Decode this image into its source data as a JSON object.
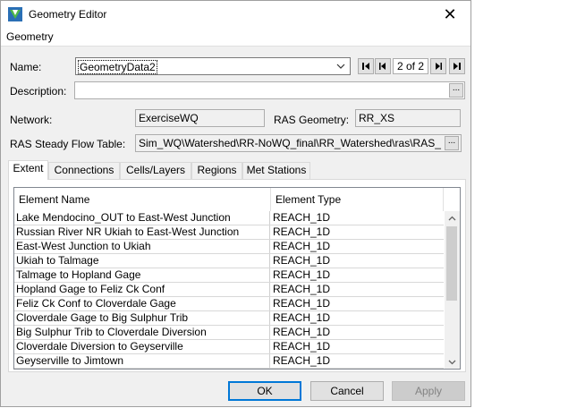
{
  "window": {
    "title": "Geometry Editor"
  },
  "menu": {
    "items": [
      "Geometry"
    ]
  },
  "name": {
    "label": "Name:",
    "value": "GeometryData2"
  },
  "nav": {
    "count": "2 of 2"
  },
  "description": {
    "label": "Description:",
    "value": ""
  },
  "network": {
    "label": "Network:",
    "value": "ExerciseWQ"
  },
  "ras_geometry": {
    "label": "RAS Geometry:",
    "value": "RR_XS"
  },
  "ras_flow": {
    "label": "RAS Steady Flow Table:",
    "value": "Sim_WQ\\Watershed\\RR-NoWQ_final\\RR_Watershed\\ras\\RAS_"
  },
  "tabs": [
    {
      "label": "Extent",
      "active": true
    },
    {
      "label": "Connections"
    },
    {
      "label": "Cells/Layers"
    },
    {
      "label": "Regions"
    },
    {
      "label": "Met Stations"
    }
  ],
  "table": {
    "headers": [
      "Element Name",
      "Element Type"
    ],
    "rows": [
      [
        "Lake Mendocino_OUT to East-West Junction",
        "REACH_1D"
      ],
      [
        "Russian River NR Ukiah to East-West Junction",
        "REACH_1D"
      ],
      [
        "East-West Junction to Ukiah",
        "REACH_1D"
      ],
      [
        "Ukiah to Talmage",
        "REACH_1D"
      ],
      [
        "Talmage to Hopland Gage",
        "REACH_1D"
      ],
      [
        "Hopland Gage to Feliz Ck Conf",
        "REACH_1D"
      ],
      [
        "Feliz Ck Conf to Cloverdale Gage",
        "REACH_1D"
      ],
      [
        "Cloverdale Gage to Big Sulphur Trib",
        "REACH_1D"
      ],
      [
        "Big Sulphur Trib to Cloverdale Diversion",
        "REACH_1D"
      ],
      [
        "Cloverdale Diversion to Geyserville",
        "REACH_1D"
      ],
      [
        "Geyserville to Jimtown",
        "REACH_1D"
      ]
    ]
  },
  "buttons": {
    "ok": "OK",
    "cancel": "Cancel",
    "apply": "Apply"
  },
  "colors": {
    "accent": "#0078d7",
    "window_bg": "#f0f0f0"
  }
}
